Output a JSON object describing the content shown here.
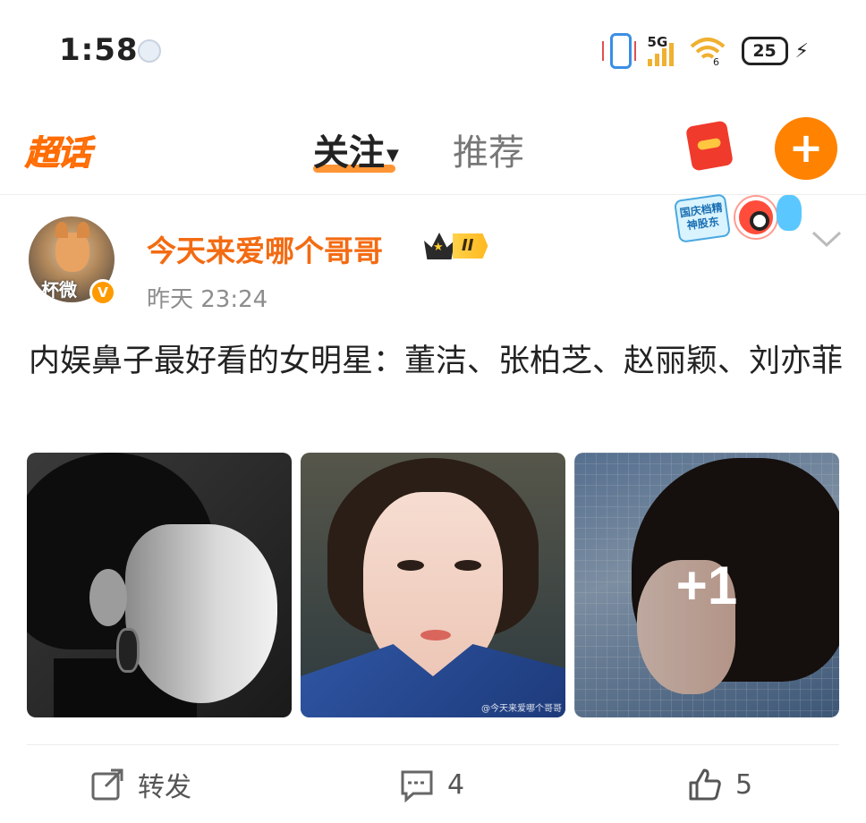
{
  "status_bar": {
    "time": "1:58",
    "network": "5G",
    "wifi_label": "6",
    "battery": "25"
  },
  "nav": {
    "supertopic_label": "超话",
    "tab_follow": "关注",
    "tab_recommend": "推荐",
    "add_label": "+"
  },
  "post": {
    "username": "今天来爱哪个哥哥",
    "vip_level": "II",
    "time": "昨天 23:24",
    "avatar_text": "杯微",
    "festival_badge_text": "国庆档精神股东",
    "text": "内娱鼻子最好看的女明星：董洁、张柏芝、赵丽颖、刘亦菲",
    "image_watermark": "@今天来爱哪个哥哥",
    "more_images": "+1",
    "actions": {
      "repost_label": "转发",
      "comment_count": "4",
      "like_count": "5"
    }
  },
  "colors": {
    "accent": "#ff8200",
    "username": "#f36b12",
    "text": "#222222",
    "muted": "#8d8d8d"
  }
}
